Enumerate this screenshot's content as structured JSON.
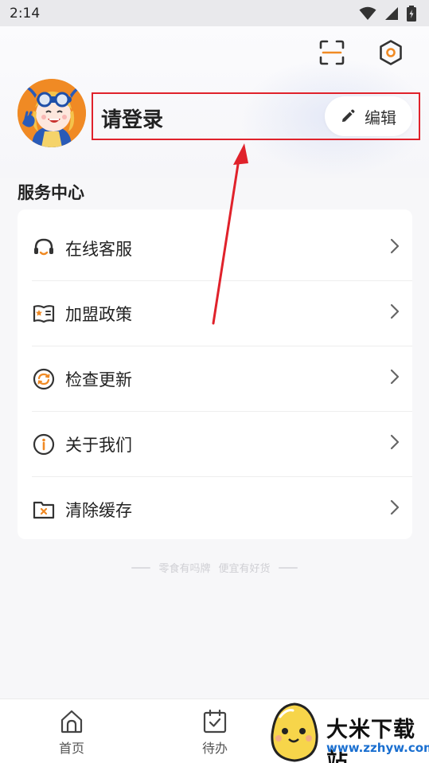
{
  "status_bar": {
    "time": "2:14"
  },
  "profile": {
    "login_text": "请登录",
    "edit_label": "编辑"
  },
  "service": {
    "title": "服务中心",
    "items": [
      {
        "label": "在线客服",
        "icon": "headset-icon"
      },
      {
        "label": "加盟政策",
        "icon": "book-star-icon"
      },
      {
        "label": "检查更新",
        "icon": "refresh-icon"
      },
      {
        "label": "关于我们",
        "icon": "info-icon"
      },
      {
        "label": "清除缓存",
        "icon": "folder-clear-icon"
      }
    ]
  },
  "slogan": {
    "left": "零食有吗牌",
    "right": "便宜有好货"
  },
  "tabbar": {
    "items": [
      {
        "label": "首页"
      },
      {
        "label": "待办"
      }
    ]
  },
  "watermark": {
    "title": "大米下载站",
    "url": "www.zzhyw.com"
  },
  "colors": {
    "accent": "#f08a24",
    "highlight_box": "#e0222b",
    "arrow": "#e0222b"
  }
}
